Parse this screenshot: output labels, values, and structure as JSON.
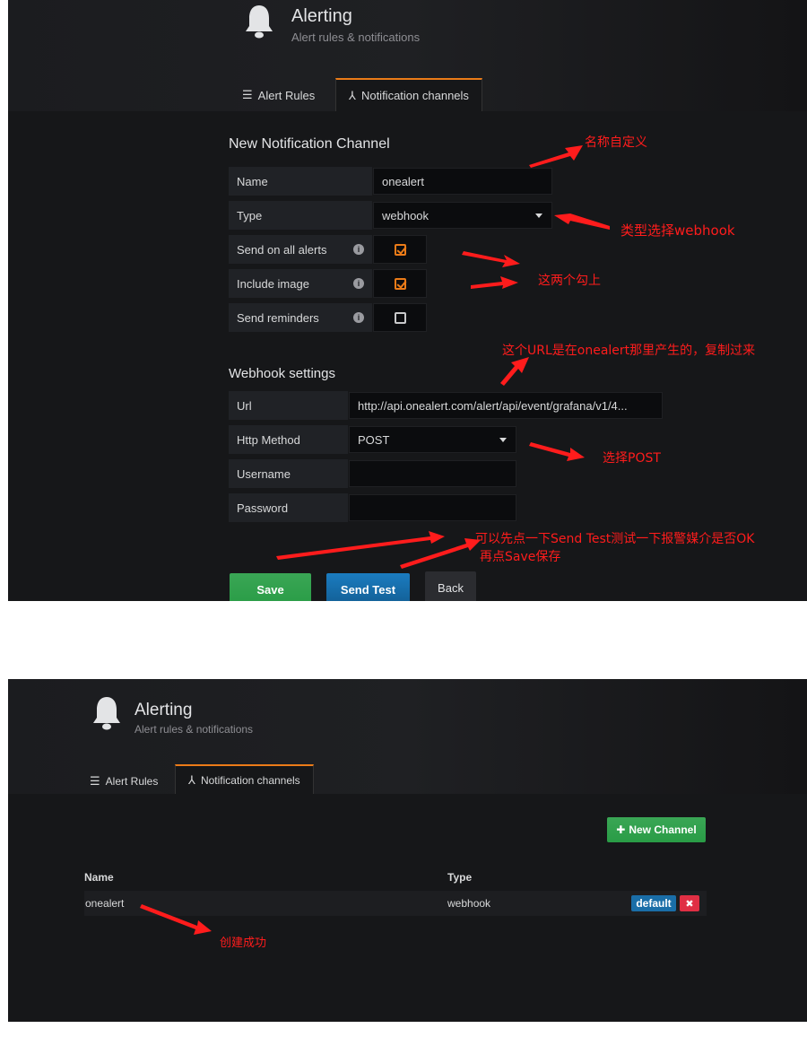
{
  "screen1": {
    "header": {
      "title": "Alerting",
      "subtitle": "Alert rules & notifications"
    },
    "tabs": [
      {
        "label": "Alert Rules",
        "icon": "list-icon",
        "active": false
      },
      {
        "label": "Notification channels",
        "icon": "share-icon",
        "active": true
      }
    ],
    "form": {
      "title": "New Notification Channel",
      "name_label": "Name",
      "name_value": "onealert",
      "type_label": "Type",
      "type_value": "webhook",
      "send_all_label": "Send on all alerts",
      "send_all_checked": true,
      "include_image_label": "Include image",
      "include_image_checked": true,
      "send_reminders_label": "Send reminders",
      "send_reminders_checked": false
    },
    "webhook": {
      "title": "Webhook settings",
      "url_label": "Url",
      "url_value": "http://api.onealert.com/alert/api/event/grafana/v1/4...",
      "method_label": "Http Method",
      "method_value": "POST",
      "username_label": "Username",
      "username_value": "",
      "password_label": "Password",
      "password_value": ""
    },
    "buttons": {
      "save": "Save",
      "send_test": "Send Test",
      "back": "Back"
    },
    "annotations": {
      "name": "名称自定义",
      "type": "类型选择webhook",
      "checks": "这两个勾上",
      "url": "这个URL是在onealert那里产生的，复制过来",
      "method": "选择POST",
      "test_line1": "可以先点一下Send Test测试一下报警媒介是否OK",
      "test_line2": "再点Save保存"
    }
  },
  "screen2": {
    "header": {
      "title": "Alerting",
      "subtitle": "Alert rules & notifications"
    },
    "tabs": [
      {
        "label": "Alert Rules",
        "icon": "list-icon",
        "active": false
      },
      {
        "label": "Notification channels",
        "icon": "share-icon",
        "active": true
      }
    ],
    "new_channel_button": "New Channel",
    "table": {
      "headers": [
        "Name",
        "Type"
      ],
      "rows": [
        {
          "name": "onealert",
          "type": "webhook",
          "badge": "default",
          "delete_icon": "close-icon"
        }
      ]
    },
    "annotation": "创建成功"
  },
  "colors": {
    "background": "#161719",
    "accent_tab": "#eb7b18",
    "save_button": "#299c46",
    "send_test_button": "#125e94",
    "annotation": "#ff1c1c",
    "default_badge": "#1a6ea8",
    "delete_badge": "#e02f44"
  }
}
